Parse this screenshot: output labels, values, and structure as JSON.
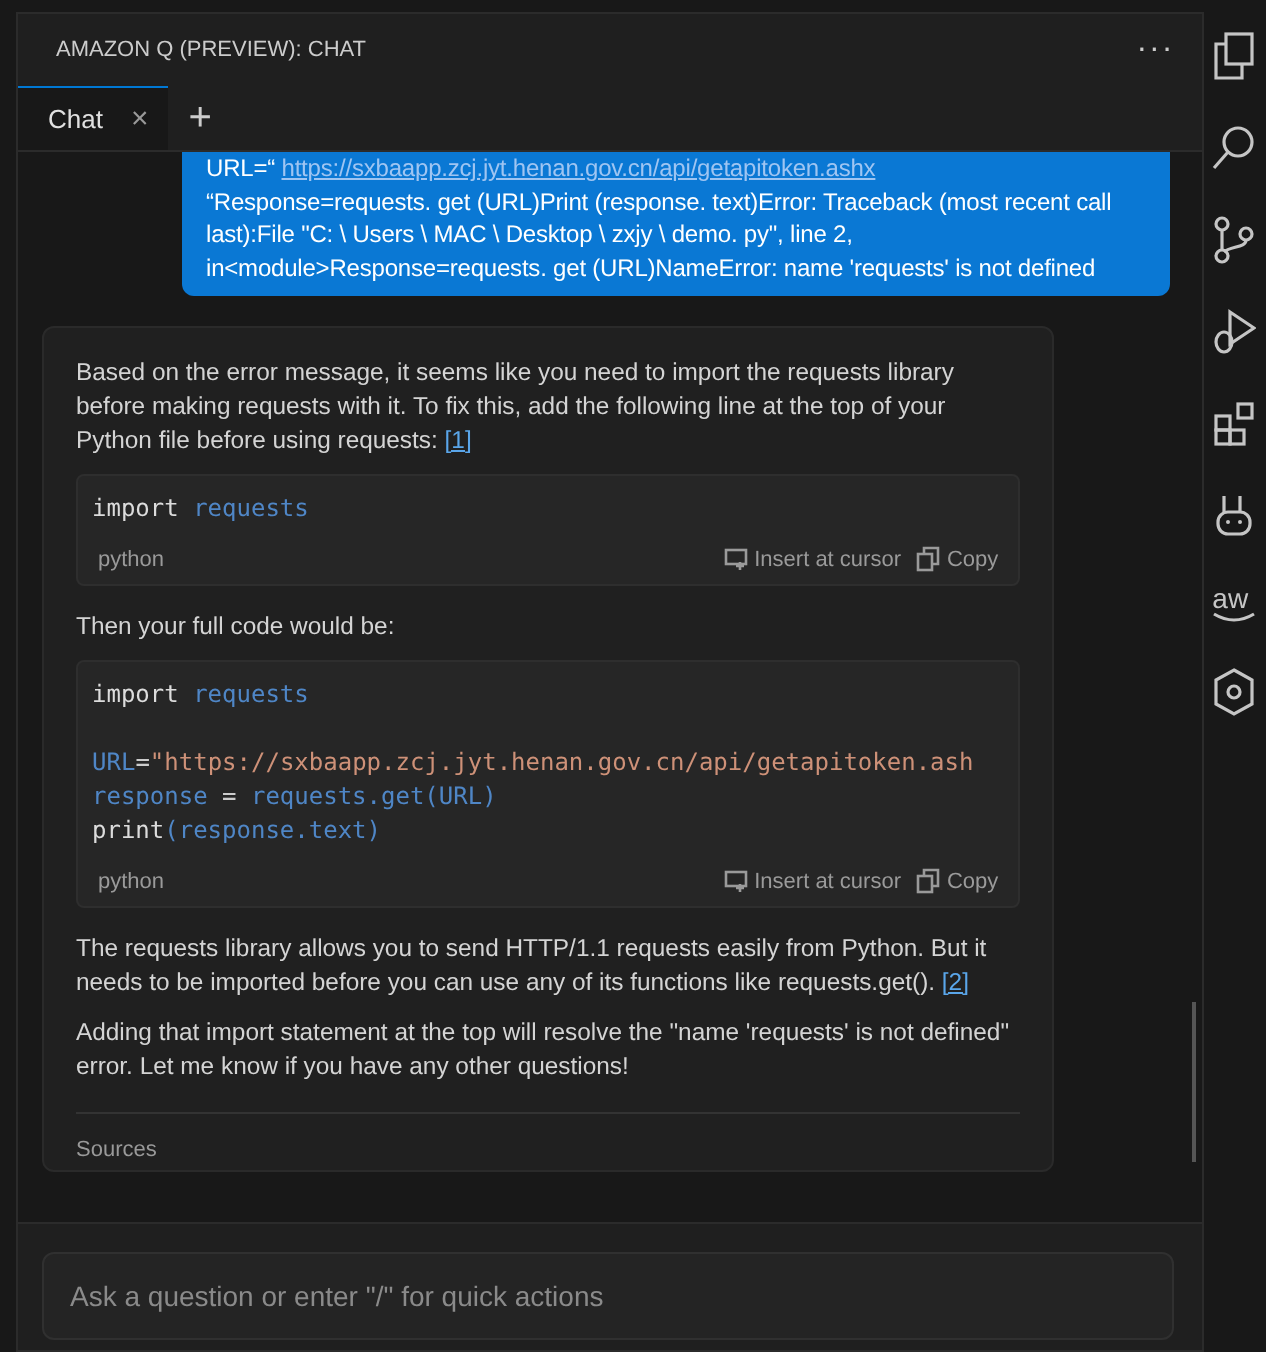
{
  "panel": {
    "title": "AMAZON Q (PREVIEW): CHAT",
    "more": "···"
  },
  "tabs": [
    {
      "label": "Chat",
      "selected": true,
      "close": "×"
    }
  ],
  "new_tab": "+",
  "user_message": {
    "lines": [
      [
        {
          "kind": "text",
          "text": "URL=“ "
        },
        {
          "kind": "link",
          "text": "https://sxbaapp.zcj.jyt.henan.gov.cn/api/getapitoken.ashx"
        }
      ],
      [
        {
          "kind": "text",
          "text": "“Response=requests. get (URL)Print (response. text)Error: Traceback (most recent call last):File \"C: \\ Users \\ MAC \\ Desktop \\ zxjy \\ demo. py\", line 2, in<module>Response=requests. get (URL)NameError: name 'requests' is not defined"
        }
      ]
    ]
  },
  "answer": {
    "blocks": [
      {
        "kind": "paragraph",
        "parts": [
          {
            "kind": "text",
            "text": "Based on the error message, it seems like you need to import the requests library before making requests with it. To fix this, add the following line at the top of your Python file before using requests: "
          },
          {
            "kind": "link",
            "text": "[1]"
          }
        ]
      },
      {
        "kind": "code",
        "language": "python",
        "actions": [
          "Insert at cursor",
          "Copy"
        ],
        "lines": [
          {
            "kind": "code",
            "tokens": [
              {
                "kind": "keyword",
                "text": "import "
              },
              {
                "kind": "name",
                "text": "requests"
              }
            ]
          }
        ]
      },
      {
        "kind": "paragraph",
        "parts": [
          {
            "kind": "text",
            "text": "Then your full code would be:"
          }
        ]
      },
      {
        "kind": "code",
        "language": "python",
        "actions": [
          "Insert at cursor",
          "Copy"
        ],
        "lines": [
          {
            "kind": "code",
            "tokens": [
              {
                "kind": "keyword",
                "text": "import "
              },
              {
                "kind": "name",
                "text": "requests"
              }
            ]
          },
          {
            "kind": "blank"
          },
          {
            "kind": "code",
            "tokens": [
              {
                "kind": "name",
                "text": "URL"
              },
              {
                "kind": "plain",
                "text": "="
              },
              {
                "kind": "string",
                "text": "\"https://sxbaapp.zcj.jyt.henan.gov.cn/api/getapitoken.ash"
              }
            ]
          },
          {
            "kind": "code",
            "tokens": [
              {
                "kind": "name",
                "text": "response"
              },
              {
                "kind": "plain",
                "text": " = "
              },
              {
                "kind": "name",
                "text": "requests.get(URL)"
              }
            ]
          },
          {
            "kind": "code",
            "tokens": [
              {
                "kind": "keyword",
                "text": "print"
              },
              {
                "kind": "name",
                "text": "(response.text)"
              }
            ]
          }
        ]
      },
      {
        "kind": "paragraph",
        "parts": [
          {
            "kind": "text",
            "text": "The requests library allows you to send HTTP/1.1 requests easily from Python. But it needs to be imported before you can use any of its functions like requests.get(). "
          },
          {
            "kind": "link",
            "text": "[2]"
          }
        ]
      },
      {
        "kind": "paragraph",
        "parts": [
          {
            "kind": "text",
            "text": "Adding that import statement at the top will resolve the \"name 'requests' is not defined\" error. Let me know if you have any other questions!"
          }
        ]
      },
      {
        "kind": "sources",
        "text": "Sources"
      }
    ]
  },
  "input": {
    "placeholder": "Ask a question or enter \"/\" for quick actions"
  },
  "activity_bar": {
    "logo_text": "aw"
  }
}
